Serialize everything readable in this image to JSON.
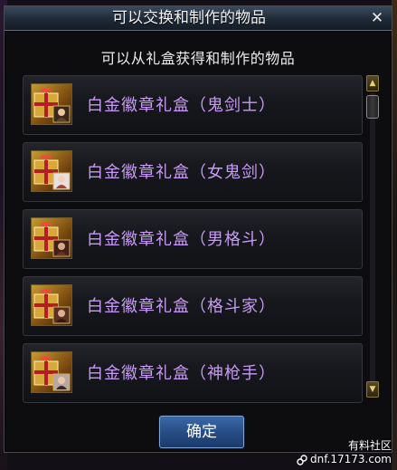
{
  "dialog": {
    "title": "可以交换和制作的物品",
    "subtitle": "可以从礼盒获得和制作的物品",
    "confirm_label": "确定"
  },
  "items": [
    {
      "name": "白金徽章礼盒（鬼剑士）",
      "icon": "gift-box-icon"
    },
    {
      "name": "白金徽章礼盒（女鬼剑）",
      "icon": "gift-box-icon"
    },
    {
      "name": "白金徽章礼盒（男格斗）",
      "icon": "gift-box-icon"
    },
    {
      "name": "白金徽章礼盒（格斗家）",
      "icon": "gift-box-icon"
    },
    {
      "name": "白金徽章礼盒（神枪手）",
      "icon": "gift-box-icon"
    }
  ],
  "watermark": {
    "line1": "有料社区",
    "line2": "dnf.17173.com"
  },
  "colors": {
    "item_name": "#c79bf5",
    "confirm_button": "#2a5088",
    "titlebar": "#1f2a38"
  }
}
